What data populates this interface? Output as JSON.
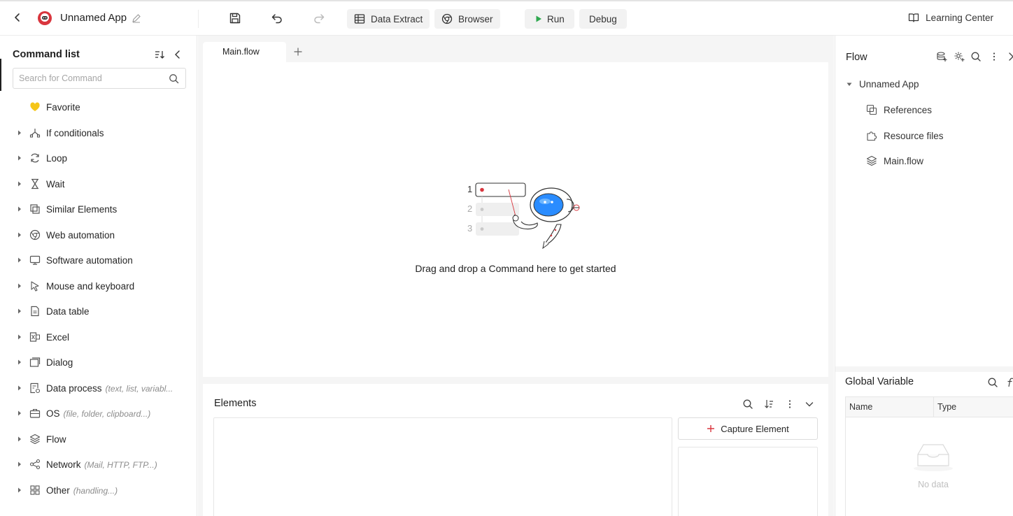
{
  "app": {
    "name": "Unnamed App"
  },
  "toolbar": {
    "data_extract": "Data Extract",
    "browser": "Browser",
    "run": "Run",
    "debug": "Debug",
    "learning_center": "Learning Center"
  },
  "sidebar": {
    "title": "Command list",
    "search_placeholder": "Search for Command",
    "items": [
      {
        "label": "Favorite",
        "hint": ""
      },
      {
        "label": "If conditionals",
        "hint": ""
      },
      {
        "label": "Loop",
        "hint": ""
      },
      {
        "label": "Wait",
        "hint": ""
      },
      {
        "label": "Similar Elements",
        "hint": ""
      },
      {
        "label": "Web automation",
        "hint": ""
      },
      {
        "label": "Software automation",
        "hint": ""
      },
      {
        "label": "Mouse and keyboard",
        "hint": ""
      },
      {
        "label": "Data table",
        "hint": ""
      },
      {
        "label": "Excel",
        "hint": ""
      },
      {
        "label": "Dialog",
        "hint": ""
      },
      {
        "label": "Data process",
        "hint": "(text, list, variabl..."
      },
      {
        "label": "OS",
        "hint": "(file, folder, clipboard...)"
      },
      {
        "label": "Flow",
        "hint": ""
      },
      {
        "label": "Network",
        "hint": "(Mail, HTTP, FTP...)"
      },
      {
        "label": "Other",
        "hint": "(handling...)"
      }
    ]
  },
  "editor": {
    "tab": "Main.flow",
    "empty_message": "Drag and drop a Command here to get started",
    "illustration_numbers": [
      "1",
      "2",
      "3"
    ]
  },
  "elements": {
    "title": "Elements",
    "capture_label": "Capture Element"
  },
  "flow_panel": {
    "title": "Flow",
    "root": "Unnamed App",
    "items": [
      {
        "label": "References",
        "icon": "references-icon"
      },
      {
        "label": "Resource files",
        "icon": "puzzle-icon"
      },
      {
        "label": "Main.flow",
        "icon": "layers-icon"
      }
    ]
  },
  "global_variable": {
    "title": "Global Variable",
    "columns": [
      "Name",
      "Type"
    ],
    "empty": "No data"
  },
  "colors": {
    "accent_red": "#d9363e",
    "run_green": "#2fa84f",
    "robot_blue": "#2a8cff"
  }
}
